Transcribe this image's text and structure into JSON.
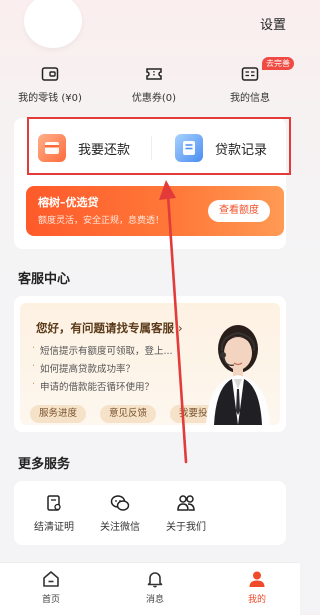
{
  "header": {
    "settings_label": "设置"
  },
  "quick": {
    "wallet_label": "我的零钱 (¥0)",
    "coupons_label": "优惠券(0)",
    "info_label": "我的信息",
    "info_badge": "去完善"
  },
  "services": {
    "repay_label": "我要还款",
    "records_label": "贷款记录"
  },
  "promo": {
    "title": "榕树–优选贷",
    "subtitle": "额度灵活，安全正规，息费透！",
    "button": "查看额度"
  },
  "customer_service": {
    "section_title": "客服中心",
    "card_title": "您好，有问题请找专属客服",
    "questions": [
      "短信提示有额度可领取，登上...",
      "如何提高贷款成功率？",
      "申请的借款能否循环使用？"
    ],
    "tags": [
      "服务进度",
      "意见反馈",
      "我要投诉"
    ]
  },
  "more_services": {
    "section_title": "更多服务",
    "items": [
      {
        "label": "结清证明",
        "icon": "certificate-icon"
      },
      {
        "label": "关注微信",
        "icon": "wechat-icon"
      },
      {
        "label": "关于我们",
        "icon": "people-icon"
      }
    ]
  },
  "tabbar": {
    "items": [
      {
        "label": "首页",
        "icon": "home-icon"
      },
      {
        "label": "消息",
        "icon": "bell-icon"
      },
      {
        "label": "我的",
        "icon": "user-icon"
      }
    ],
    "active": "我的"
  },
  "colors": {
    "accent": "#f04a2a",
    "annotation_red": "#e33a3a",
    "badge": "#f04a43"
  }
}
